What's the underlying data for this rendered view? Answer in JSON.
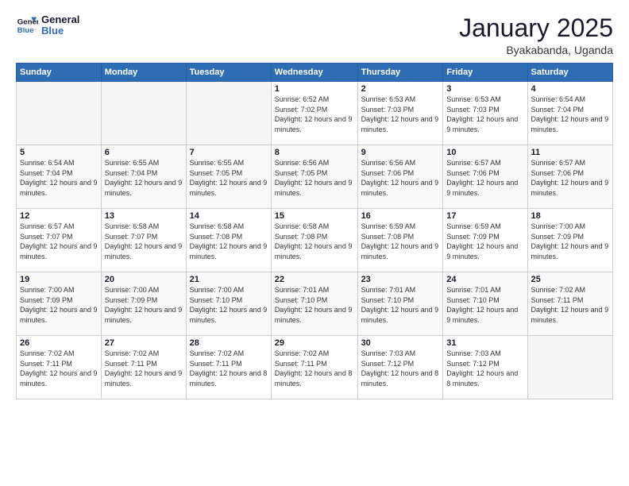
{
  "logo": {
    "line1": "General",
    "line2": "Blue"
  },
  "title": "January 2025",
  "subtitle": "Byakabanda, Uganda",
  "weekdays": [
    "Sunday",
    "Monday",
    "Tuesday",
    "Wednesday",
    "Thursday",
    "Friday",
    "Saturday"
  ],
  "weeks": [
    [
      {
        "day": "",
        "empty": true
      },
      {
        "day": "",
        "empty": true
      },
      {
        "day": "",
        "empty": true
      },
      {
        "day": "1",
        "sunrise": "6:52 AM",
        "sunset": "7:02 PM",
        "daylight": "12 hours and 9 minutes."
      },
      {
        "day": "2",
        "sunrise": "6:53 AM",
        "sunset": "7:03 PM",
        "daylight": "12 hours and 9 minutes."
      },
      {
        "day": "3",
        "sunrise": "6:53 AM",
        "sunset": "7:03 PM",
        "daylight": "12 hours and 9 minutes."
      },
      {
        "day": "4",
        "sunrise": "6:54 AM",
        "sunset": "7:04 PM",
        "daylight": "12 hours and 9 minutes."
      }
    ],
    [
      {
        "day": "5",
        "sunrise": "6:54 AM",
        "sunset": "7:04 PM",
        "daylight": "12 hours and 9 minutes."
      },
      {
        "day": "6",
        "sunrise": "6:55 AM",
        "sunset": "7:04 PM",
        "daylight": "12 hours and 9 minutes."
      },
      {
        "day": "7",
        "sunrise": "6:55 AM",
        "sunset": "7:05 PM",
        "daylight": "12 hours and 9 minutes."
      },
      {
        "day": "8",
        "sunrise": "6:56 AM",
        "sunset": "7:05 PM",
        "daylight": "12 hours and 9 minutes."
      },
      {
        "day": "9",
        "sunrise": "6:56 AM",
        "sunset": "7:06 PM",
        "daylight": "12 hours and 9 minutes."
      },
      {
        "day": "10",
        "sunrise": "6:57 AM",
        "sunset": "7:06 PM",
        "daylight": "12 hours and 9 minutes."
      },
      {
        "day": "11",
        "sunrise": "6:57 AM",
        "sunset": "7:06 PM",
        "daylight": "12 hours and 9 minutes."
      }
    ],
    [
      {
        "day": "12",
        "sunrise": "6:57 AM",
        "sunset": "7:07 PM",
        "daylight": "12 hours and 9 minutes."
      },
      {
        "day": "13",
        "sunrise": "6:58 AM",
        "sunset": "7:07 PM",
        "daylight": "12 hours and 9 minutes."
      },
      {
        "day": "14",
        "sunrise": "6:58 AM",
        "sunset": "7:08 PM",
        "daylight": "12 hours and 9 minutes."
      },
      {
        "day": "15",
        "sunrise": "6:58 AM",
        "sunset": "7:08 PM",
        "daylight": "12 hours and 9 minutes."
      },
      {
        "day": "16",
        "sunrise": "6:59 AM",
        "sunset": "7:08 PM",
        "daylight": "12 hours and 9 minutes."
      },
      {
        "day": "17",
        "sunrise": "6:59 AM",
        "sunset": "7:09 PM",
        "daylight": "12 hours and 9 minutes."
      },
      {
        "day": "18",
        "sunrise": "7:00 AM",
        "sunset": "7:09 PM",
        "daylight": "12 hours and 9 minutes."
      }
    ],
    [
      {
        "day": "19",
        "sunrise": "7:00 AM",
        "sunset": "7:09 PM",
        "daylight": "12 hours and 9 minutes."
      },
      {
        "day": "20",
        "sunrise": "7:00 AM",
        "sunset": "7:09 PM",
        "daylight": "12 hours and 9 minutes."
      },
      {
        "day": "21",
        "sunrise": "7:00 AM",
        "sunset": "7:10 PM",
        "daylight": "12 hours and 9 minutes."
      },
      {
        "day": "22",
        "sunrise": "7:01 AM",
        "sunset": "7:10 PM",
        "daylight": "12 hours and 9 minutes."
      },
      {
        "day": "23",
        "sunrise": "7:01 AM",
        "sunset": "7:10 PM",
        "daylight": "12 hours and 9 minutes."
      },
      {
        "day": "24",
        "sunrise": "7:01 AM",
        "sunset": "7:10 PM",
        "daylight": "12 hours and 9 minutes."
      },
      {
        "day": "25",
        "sunrise": "7:02 AM",
        "sunset": "7:11 PM",
        "daylight": "12 hours and 9 minutes."
      }
    ],
    [
      {
        "day": "26",
        "sunrise": "7:02 AM",
        "sunset": "7:11 PM",
        "daylight": "12 hours and 9 minutes."
      },
      {
        "day": "27",
        "sunrise": "7:02 AM",
        "sunset": "7:11 PM",
        "daylight": "12 hours and 9 minutes."
      },
      {
        "day": "28",
        "sunrise": "7:02 AM",
        "sunset": "7:11 PM",
        "daylight": "12 hours and 8 minutes."
      },
      {
        "day": "29",
        "sunrise": "7:02 AM",
        "sunset": "7:11 PM",
        "daylight": "12 hours and 8 minutes."
      },
      {
        "day": "30",
        "sunrise": "7:03 AM",
        "sunset": "7:12 PM",
        "daylight": "12 hours and 8 minutes."
      },
      {
        "day": "31",
        "sunrise": "7:03 AM",
        "sunset": "7:12 PM",
        "daylight": "12 hours and 8 minutes."
      },
      {
        "day": "",
        "empty": true
      }
    ]
  ]
}
